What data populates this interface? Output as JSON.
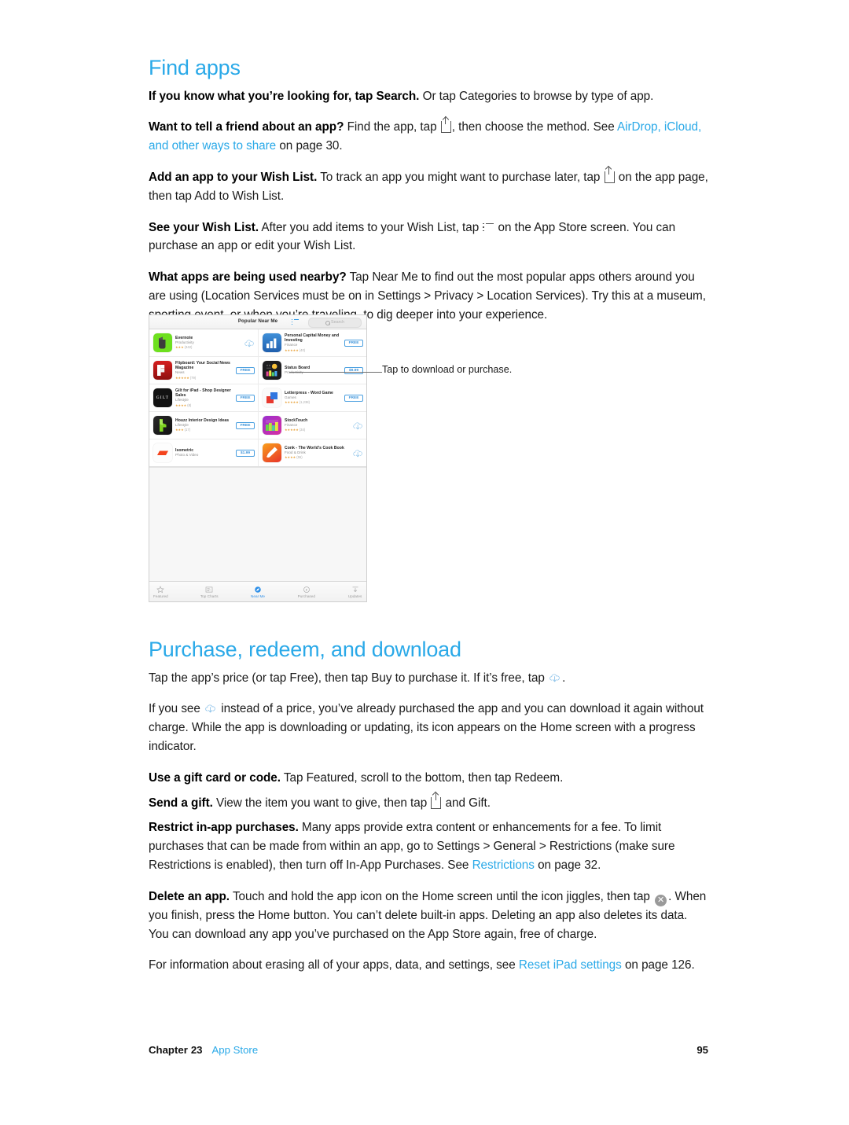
{
  "document": {
    "page_number": "95",
    "chapter_label": "Chapter",
    "chapter_number": "23",
    "chapter_title": "App Store"
  },
  "sections": [
    {
      "id": "find-apps",
      "heading": "Find apps",
      "paragraphs": [
        {
          "lead": "If you know what you’re looking for, tap Search.",
          "rest": " Or tap Categories to browse by type of app."
        },
        {
          "lead": "Want to tell a friend about an app?",
          "rest_a": " Find the app, tap ",
          "rest_b": ", then choose the method. See ",
          "link": "AirDrop, iCloud, and other ways to share",
          "rest_c": " on page 30."
        },
        {
          "lead": "Add an app to your Wish List.",
          "rest_a": " To track an app you might want to purchase later, tap ",
          "rest_b": " on the app page, then tap Add to Wish List."
        },
        {
          "lead": "See your Wish List.",
          "rest_a": " After you add items to your Wish List, tap ",
          "rest_b": " on the App Store screen. You can purchase an app or edit your Wish List."
        },
        {
          "lead": "What apps are being used nearby?",
          "rest": "  Tap Near Me to find out the most popular apps others around you are using (Location Services must be on in Settings > Privacy > Location Services). Try this at a museum, sporting event, or when you’re traveling, to dig deeper into your experience."
        }
      ]
    },
    {
      "id": "purchase-redeem-download",
      "heading": "Purchase, redeem, and download",
      "paragraphs": [
        {
          "rest_a": "Tap the app’s price (or tap Free), then tap Buy to purchase it. If it’s free, tap ",
          "rest_b": "."
        },
        {
          "rest_a": "If you see ",
          "rest_b": " instead of a price, you’ve already purchased the app and you can download it again without charge. While the app is downloading or updating, its icon appears on the Home screen with a progress indicator."
        },
        {
          "lead": "Use a gift card or code.",
          "rest": " Tap Featured, scroll to the bottom, then tap Redeem."
        },
        {
          "lead": "Send a gift.",
          "rest_a": " View the item you want to give, then tap ",
          "rest_b": " and Gift."
        },
        {
          "lead": "Restrict in-app purchases.",
          "rest_a": " Many apps provide extra content or enhancements for a fee. To limit purchases that can be made from within an app, go to Settings > General > Restrictions (make sure Restrictions is enabled), then turn off In-App Purchases. See ",
          "link": "Restrictions",
          "rest_b": " on page 32."
        },
        {
          "lead": "Delete an app.",
          "rest_a": " Touch and hold the app icon on the Home screen until the icon jiggles, then tap ",
          "rest_b": ". When you finish, press the Home button. You can’t delete built-in apps. Deleting an app also deletes its data. You can download any app you’ve purchased on the App Store again, free of charge."
        },
        {
          "rest_a": "For information about erasing all of your apps, data, and settings, see ",
          "link": "Reset iPad settings",
          "rest_b": " on page 126."
        }
      ]
    }
  ],
  "figure": {
    "callout": "Tap to download or purchase.",
    "nav": {
      "title": "Popular Near Me",
      "wishlist_icon": "list-icon",
      "search_placeholder": "Search",
      "search_icon": "search-icon"
    },
    "apps": [
      {
        "name": "Evernote",
        "category": "Productivity",
        "stars": "★★★",
        "count": "(342)",
        "action": "download",
        "price": "",
        "icon": "evernote-icon"
      },
      {
        "name": "Personal Capital Money and Investing",
        "category": "Finance",
        "stars": "★★★★★",
        "count": "(40)",
        "action": "price",
        "price": "FREE",
        "icon": "personal-capital-icon"
      },
      {
        "name": "Flipboard: Your Social News Magazine",
        "category": "News",
        "stars": "★★★★★",
        "count": "(79)",
        "action": "price",
        "price": "FREE",
        "icon": "flipboard-icon"
      },
      {
        "name": "Status Board",
        "category": "Productivity",
        "stars": "",
        "count": "",
        "action": "price",
        "price": "$9.99",
        "icon": "status-board-icon"
      },
      {
        "name": "Gilt for iPad - Shop Designer Sales",
        "category": "Lifestyle",
        "stars": "★★★★",
        "count": "(8)",
        "action": "price",
        "price": "FREE",
        "icon": "gilt-icon"
      },
      {
        "name": "Letterpress - Word Game",
        "category": "Games",
        "stars": "★★★★★",
        "count": "(1,238)",
        "action": "price",
        "price": "FREE",
        "icon": "letterpress-icon"
      },
      {
        "name": "Houzz Interior Design Ideas",
        "category": "Lifestyle",
        "stars": "★★★",
        "count": "(17)",
        "action": "price",
        "price": "FREE",
        "icon": "houzz-icon"
      },
      {
        "name": "StockTouch",
        "category": "Finance",
        "stars": "★★★★★",
        "count": "(34)",
        "action": "download",
        "price": "",
        "icon": "stocktouch-icon"
      },
      {
        "name": "Isometric",
        "category": "Photo & Video",
        "stars": "",
        "count": "",
        "action": "price",
        "price": "$1.99",
        "icon": "isometric-icon"
      },
      {
        "name": "Conk - The World’s Cook Book",
        "category": "Food & Drink",
        "stars": "★★★★",
        "count": "(55)",
        "action": "download",
        "price": "",
        "icon": "conk-icon"
      }
    ],
    "tabs": [
      {
        "label": "Featured",
        "icon": "star-icon",
        "active": false
      },
      {
        "label": "Top Charts",
        "icon": "charts-icon",
        "active": false
      },
      {
        "label": "Near Me",
        "icon": "near-me-icon",
        "active": true
      },
      {
        "label": "Purchased",
        "icon": "purchased-icon",
        "active": false
      },
      {
        "label": "Updates",
        "icon": "updates-icon",
        "active": false
      }
    ]
  },
  "colors": {
    "accent": "#2aa9e8",
    "link": "#2aa9e8",
    "text": "#1a1a1a",
    "price_blue": "#3b93da",
    "star_gold": "#e8a33d"
  }
}
